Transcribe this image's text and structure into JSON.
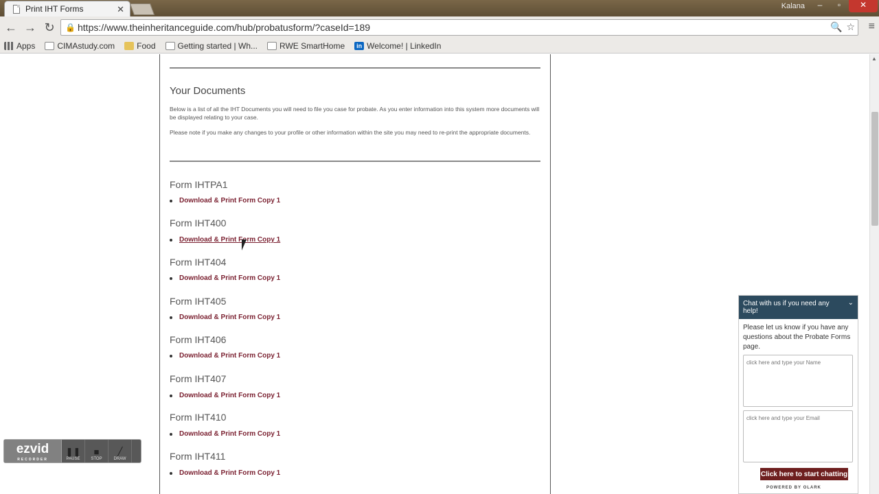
{
  "browser": {
    "tab_title": "Print IHT Forms",
    "tab_close": "✕",
    "user": "Kalana",
    "url": "https://www.theinheritanceguide.com/hub/probatusform/?caseId=189",
    "bookmarks": [
      {
        "label": "Apps",
        "icon": "apps-icon"
      },
      {
        "label": "CIMAstudy.com",
        "icon": "page-icon"
      },
      {
        "label": "Food",
        "icon": "folder-icon"
      },
      {
        "label": "Getting started | Wh...",
        "icon": "page-icon"
      },
      {
        "label": "RWE SmartHome",
        "icon": "page-icon"
      },
      {
        "label": "Welcome! | LinkedIn",
        "icon": "linkedin-icon"
      }
    ]
  },
  "main": {
    "section_title": "Your Documents",
    "intro_1": "Below is a list of all the IHT Documents you will need to file you case for probate. As you enter information into this system more documents will be displayed relating to your case.",
    "intro_2": "Please note if you make any changes to your profile or other information within the site you may need to re-print the appropriate documents.",
    "forms": [
      {
        "title": "Form IHTPA1",
        "link": "Download & Print Form Copy 1"
      },
      {
        "title": "Form IHT400",
        "link": "Download & Print Form Copy 1"
      },
      {
        "title": "Form IHT404",
        "link": "Download & Print Form Copy 1"
      },
      {
        "title": "Form IHT405",
        "link": "Download & Print Form Copy 1"
      },
      {
        "title": "Form IHT406",
        "link": "Download & Print Form Copy 1"
      },
      {
        "title": "Form IHT407",
        "link": "Download & Print Form Copy 1"
      },
      {
        "title": "Form IHT410",
        "link": "Download & Print Form Copy 1"
      },
      {
        "title": "Form IHT411",
        "link": "Download & Print Form Copy 1"
      }
    ]
  },
  "chat": {
    "header": "Chat with us if you need any help!",
    "message": "Please let us know if you have any questions about the Probate Forms page.",
    "name_placeholder": "click here and type your Name",
    "email_placeholder": "click here and type your Email",
    "button": "Click here to start chatting",
    "powered": "POWERED BY OLARK"
  },
  "overlay": {
    "logo": "ezvid",
    "logo_sub": "RECORDER",
    "pause": "PAUSE",
    "stop": "STOP",
    "draw": "DRAW"
  }
}
